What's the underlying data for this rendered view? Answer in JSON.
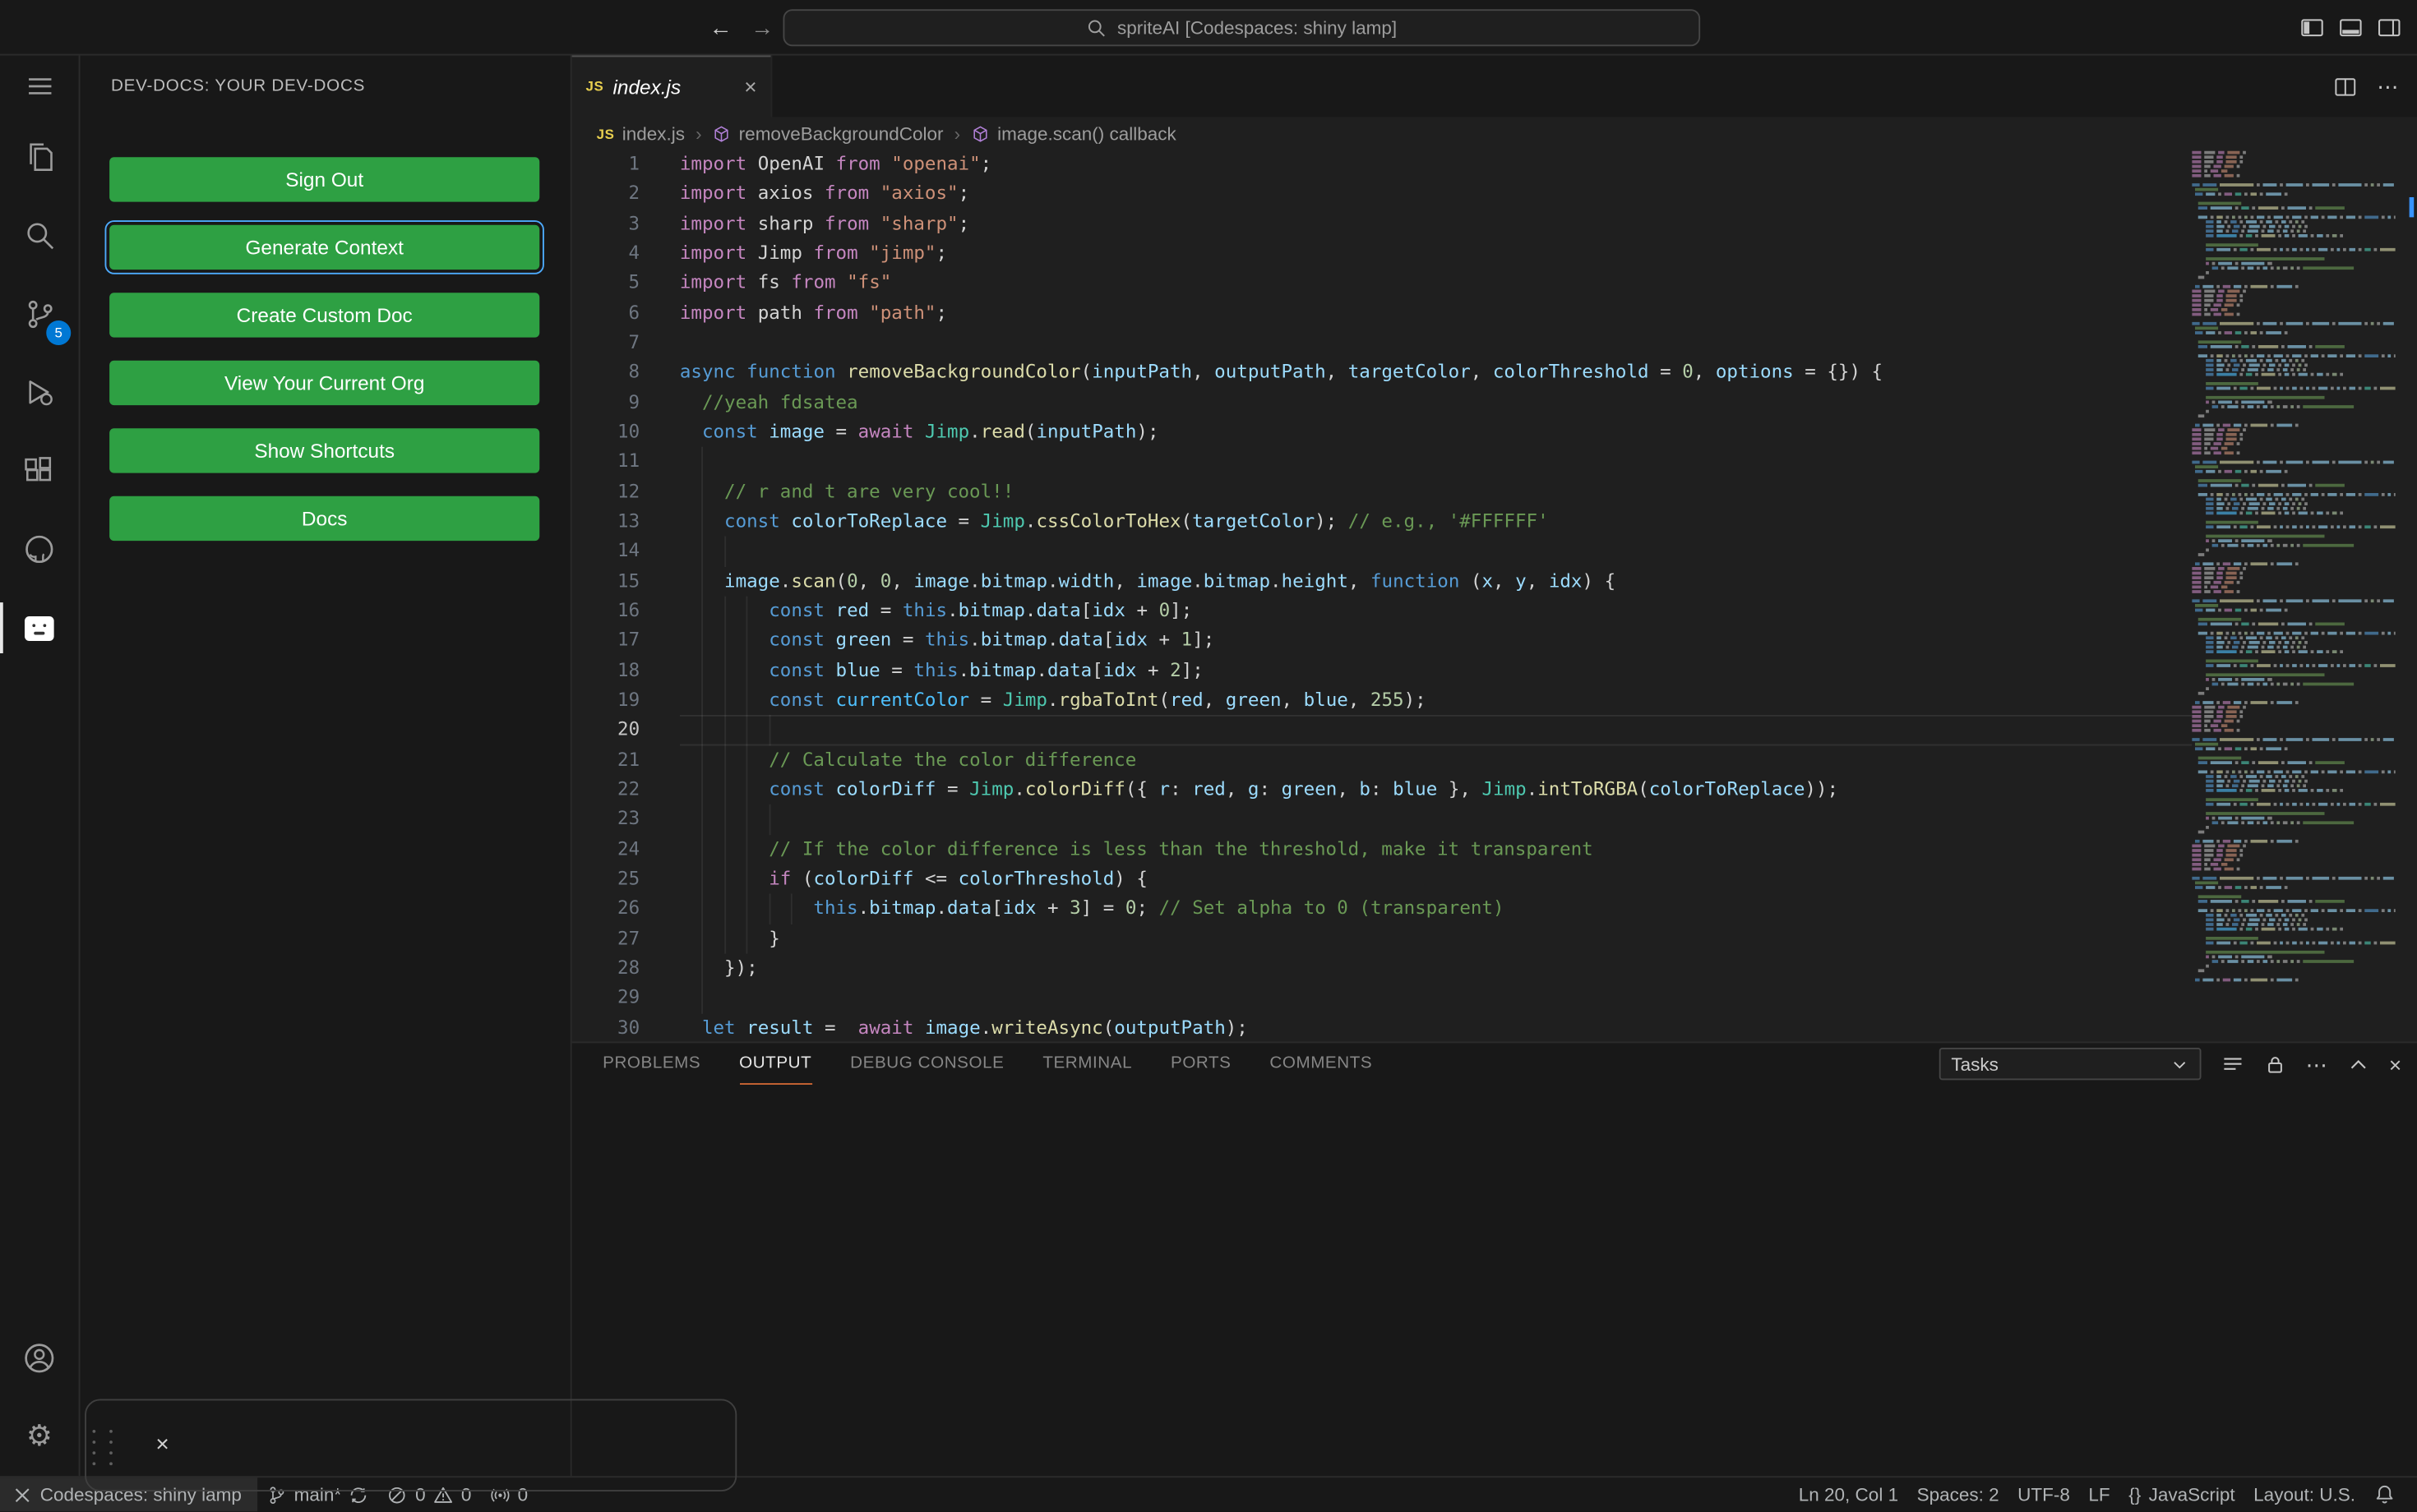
{
  "colors": {
    "accent_green": "#2ea043",
    "focus_blue": "#4daafc",
    "badge_blue": "#0078d4",
    "panel_active_border": "#cc6633"
  },
  "icons": {
    "back": "←",
    "forward": "→",
    "more": "⋯",
    "close": "×",
    "gear": "⚙",
    "js": "JS",
    "braces": "{}"
  },
  "titlebar": {
    "search_label": "spriteAI [Codespaces: shiny lamp]"
  },
  "activity_bar": {
    "source_control_badge": "5"
  },
  "sidebar": {
    "title": "DEV-DOCS: YOUR DEV-DOCS",
    "buttons": [
      {
        "label": "Sign Out",
        "focused": false
      },
      {
        "label": "Generate Context",
        "focused": true
      },
      {
        "label": "Create Custom Doc",
        "focused": false
      },
      {
        "label": "View Your Current Org",
        "focused": false
      },
      {
        "label": "Show Shortcuts",
        "focused": false
      },
      {
        "label": "Docs",
        "focused": false
      }
    ]
  },
  "editor": {
    "tab": {
      "label": "index.js"
    },
    "breadcrumbs": [
      {
        "label": "index.js",
        "icon": "js"
      },
      {
        "label": "removeBackgroundColor",
        "icon": "symbol"
      },
      {
        "label": "image.scan() callback",
        "icon": "symbol"
      }
    ],
    "active_line": 20,
    "lines": [
      {
        "n": 1,
        "i": 0,
        "t": [
          [
            "k",
            "import "
          ],
          [
            "p",
            "OpenAI "
          ],
          [
            "k",
            "from "
          ],
          [
            "s",
            "\"openai\""
          ],
          [
            "p",
            ";"
          ]
        ]
      },
      {
        "n": 2,
        "i": 0,
        "t": [
          [
            "k",
            "import "
          ],
          [
            "p",
            "axios "
          ],
          [
            "k",
            "from "
          ],
          [
            "s",
            "\"axios\""
          ],
          [
            "p",
            ";"
          ]
        ]
      },
      {
        "n": 3,
        "i": 0,
        "t": [
          [
            "k",
            "import "
          ],
          [
            "p",
            "sharp "
          ],
          [
            "k",
            "from "
          ],
          [
            "s",
            "\"sharp\""
          ],
          [
            "p",
            ";"
          ]
        ]
      },
      {
        "n": 4,
        "i": 0,
        "t": [
          [
            "k",
            "import "
          ],
          [
            "p",
            "Jimp "
          ],
          [
            "k",
            "from "
          ],
          [
            "s",
            "\"jimp\""
          ],
          [
            "p",
            ";"
          ]
        ]
      },
      {
        "n": 5,
        "i": 0,
        "t": [
          [
            "k",
            "import "
          ],
          [
            "p",
            "fs "
          ],
          [
            "k",
            "from "
          ],
          [
            "s",
            "\"fs\""
          ]
        ]
      },
      {
        "n": 6,
        "i": 0,
        "t": [
          [
            "k",
            "import "
          ],
          [
            "p",
            "path "
          ],
          [
            "k",
            "from "
          ],
          [
            "s",
            "\"path\""
          ],
          [
            "p",
            ";"
          ]
        ]
      },
      {
        "n": 7,
        "i": 0,
        "t": []
      },
      {
        "n": 8,
        "i": 0,
        "t": [
          [
            "d",
            "async "
          ],
          [
            "d",
            "function "
          ],
          [
            "f",
            "removeBackgroundColor"
          ],
          [
            "p",
            "("
          ],
          [
            "v",
            "inputPath"
          ],
          [
            "p",
            ", "
          ],
          [
            "v",
            "outputPath"
          ],
          [
            "p",
            ", "
          ],
          [
            "v",
            "targetColor"
          ],
          [
            "p",
            ", "
          ],
          [
            "v",
            "colorThreshold"
          ],
          [
            "p",
            " = "
          ],
          [
            "n",
            "0"
          ],
          [
            "p",
            ", "
          ],
          [
            "v",
            "options"
          ],
          [
            "p",
            " = {}) {"
          ]
        ]
      },
      {
        "n": 9,
        "i": 2,
        "t": [
          [
            "c",
            "//yeah fdsatea"
          ]
        ]
      },
      {
        "n": 10,
        "i": 2,
        "t": [
          [
            "d",
            "const "
          ],
          [
            "v",
            "image"
          ],
          [
            "p",
            " = "
          ],
          [
            "k",
            "await "
          ],
          [
            "t",
            "Jimp"
          ],
          [
            "p",
            "."
          ],
          [
            "f",
            "read"
          ],
          [
            "p",
            "("
          ],
          [
            "v",
            "inputPath"
          ],
          [
            "p",
            ");"
          ]
        ]
      },
      {
        "n": 11,
        "i": 2,
        "t": []
      },
      {
        "n": 12,
        "i": 4,
        "t": [
          [
            "c",
            "// r and t are very cool!!"
          ]
        ]
      },
      {
        "n": 13,
        "i": 4,
        "t": [
          [
            "d",
            "const "
          ],
          [
            "v",
            "colorToReplace"
          ],
          [
            "p",
            " = "
          ],
          [
            "t",
            "Jimp"
          ],
          [
            "p",
            "."
          ],
          [
            "f",
            "cssColorToHex"
          ],
          [
            "p",
            "("
          ],
          [
            "v",
            "targetColor"
          ],
          [
            "p",
            ");"
          ],
          [
            "c",
            " // e.g., '#FFFFFF'"
          ]
        ]
      },
      {
        "n": 14,
        "i": 4,
        "t": []
      },
      {
        "n": 15,
        "i": 4,
        "t": [
          [
            "v",
            "image"
          ],
          [
            "p",
            "."
          ],
          [
            "f",
            "scan"
          ],
          [
            "p",
            "("
          ],
          [
            "n",
            "0"
          ],
          [
            "p",
            ", "
          ],
          [
            "n",
            "0"
          ],
          [
            "p",
            ", "
          ],
          [
            "v",
            "image"
          ],
          [
            "p",
            "."
          ],
          [
            "v",
            "bitmap"
          ],
          [
            "p",
            "."
          ],
          [
            "v",
            "width"
          ],
          [
            "p",
            ", "
          ],
          [
            "v",
            "image"
          ],
          [
            "p",
            "."
          ],
          [
            "v",
            "bitmap"
          ],
          [
            "p",
            "."
          ],
          [
            "v",
            "height"
          ],
          [
            "p",
            ", "
          ],
          [
            "d",
            "function "
          ],
          [
            "p",
            "("
          ],
          [
            "v",
            "x"
          ],
          [
            "p",
            ", "
          ],
          [
            "v",
            "y"
          ],
          [
            "p",
            ", "
          ],
          [
            "v",
            "idx"
          ],
          [
            "p",
            ") {"
          ]
        ]
      },
      {
        "n": 16,
        "i": 8,
        "t": [
          [
            "d",
            "const "
          ],
          [
            "v",
            "red"
          ],
          [
            "p",
            " = "
          ],
          [
            "d",
            "this"
          ],
          [
            "p",
            "."
          ],
          [
            "v",
            "bitmap"
          ],
          [
            "p",
            "."
          ],
          [
            "v",
            "data"
          ],
          [
            "p",
            "["
          ],
          [
            "v",
            "idx"
          ],
          [
            "p",
            " + "
          ],
          [
            "n",
            "0"
          ],
          [
            "p",
            "];"
          ]
        ]
      },
      {
        "n": 17,
        "i": 8,
        "t": [
          [
            "d",
            "const "
          ],
          [
            "v",
            "green"
          ],
          [
            "p",
            " = "
          ],
          [
            "d",
            "this"
          ],
          [
            "p",
            "."
          ],
          [
            "v",
            "bitmap"
          ],
          [
            "p",
            "."
          ],
          [
            "v",
            "data"
          ],
          [
            "p",
            "["
          ],
          [
            "v",
            "idx"
          ],
          [
            "p",
            " + "
          ],
          [
            "n",
            "1"
          ],
          [
            "p",
            "];"
          ]
        ]
      },
      {
        "n": 18,
        "i": 8,
        "t": [
          [
            "d",
            "const "
          ],
          [
            "v",
            "blue"
          ],
          [
            "p",
            " = "
          ],
          [
            "d",
            "this"
          ],
          [
            "p",
            "."
          ],
          [
            "v",
            "bitmap"
          ],
          [
            "p",
            "."
          ],
          [
            "v",
            "data"
          ],
          [
            "p",
            "["
          ],
          [
            "v",
            "idx"
          ],
          [
            "p",
            " + "
          ],
          [
            "n",
            "2"
          ],
          [
            "p",
            "];"
          ]
        ]
      },
      {
        "n": 19,
        "i": 8,
        "t": [
          [
            "d",
            "const "
          ],
          [
            "u",
            "currentColor"
          ],
          [
            "p",
            " = "
          ],
          [
            "t",
            "Jimp"
          ],
          [
            "p",
            "."
          ],
          [
            "f",
            "rgbaToInt"
          ],
          [
            "p",
            "("
          ],
          [
            "v",
            "red"
          ],
          [
            "p",
            ", "
          ],
          [
            "v",
            "green"
          ],
          [
            "p",
            ", "
          ],
          [
            "v",
            "blue"
          ],
          [
            "p",
            ", "
          ],
          [
            "n",
            "255"
          ],
          [
            "p",
            ");"
          ]
        ]
      },
      {
        "n": 20,
        "i": 8,
        "t": []
      },
      {
        "n": 21,
        "i": 8,
        "t": [
          [
            "c",
            "// Calculate the color difference"
          ]
        ]
      },
      {
        "n": 22,
        "i": 8,
        "t": [
          [
            "d",
            "const "
          ],
          [
            "v",
            "colorDiff"
          ],
          [
            "p",
            " = "
          ],
          [
            "t",
            "Jimp"
          ],
          [
            "p",
            "."
          ],
          [
            "f",
            "colorDiff"
          ],
          [
            "p",
            "({ "
          ],
          [
            "v",
            "r"
          ],
          [
            "p",
            ": "
          ],
          [
            "v",
            "red"
          ],
          [
            "p",
            ", "
          ],
          [
            "v",
            "g"
          ],
          [
            "p",
            ": "
          ],
          [
            "v",
            "green"
          ],
          [
            "p",
            ", "
          ],
          [
            "v",
            "b"
          ],
          [
            "p",
            ": "
          ],
          [
            "v",
            "blue"
          ],
          [
            "p",
            " }, "
          ],
          [
            "t",
            "Jimp"
          ],
          [
            "p",
            "."
          ],
          [
            "f",
            "intToRGBA"
          ],
          [
            "p",
            "("
          ],
          [
            "v",
            "colorToReplace"
          ],
          [
            "p",
            "));"
          ]
        ]
      },
      {
        "n": 23,
        "i": 8,
        "t": []
      },
      {
        "n": 24,
        "i": 8,
        "t": [
          [
            "c",
            "// If the color difference is less than the threshold, make it transparent"
          ]
        ]
      },
      {
        "n": 25,
        "i": 8,
        "t": [
          [
            "k",
            "if "
          ],
          [
            "p",
            "("
          ],
          [
            "v",
            "colorDiff"
          ],
          [
            "p",
            " <= "
          ],
          [
            "v",
            "colorThreshold"
          ],
          [
            "p",
            ") {"
          ]
        ]
      },
      {
        "n": 26,
        "i": 12,
        "t": [
          [
            "d",
            "this"
          ],
          [
            "p",
            "."
          ],
          [
            "v",
            "bitmap"
          ],
          [
            "p",
            "."
          ],
          [
            "v",
            "data"
          ],
          [
            "p",
            "["
          ],
          [
            "v",
            "idx"
          ],
          [
            "p",
            " + "
          ],
          [
            "n",
            "3"
          ],
          [
            "p",
            "] = "
          ],
          [
            "n",
            "0"
          ],
          [
            "p",
            ";"
          ],
          [
            "c",
            " // Set alpha to 0 (transparent)"
          ]
        ]
      },
      {
        "n": 27,
        "i": 8,
        "t": [
          [
            "p",
            "}"
          ]
        ]
      },
      {
        "n": 28,
        "i": 4,
        "t": [
          [
            "p",
            "});"
          ]
        ]
      },
      {
        "n": 29,
        "i": 2,
        "t": []
      },
      {
        "n": 30,
        "i": 2,
        "t": [
          [
            "d",
            "let "
          ],
          [
            "v",
            "result"
          ],
          [
            "p",
            " =  "
          ],
          [
            "k",
            "await "
          ],
          [
            "v",
            "image"
          ],
          [
            "p",
            "."
          ],
          [
            "f",
            "writeAsync"
          ],
          [
            "p",
            "("
          ],
          [
            "v",
            "outputPath"
          ],
          [
            "p",
            ");"
          ]
        ]
      }
    ]
  },
  "panel": {
    "tabs": [
      {
        "label": "PROBLEMS",
        "active": false
      },
      {
        "label": "OUTPUT",
        "active": true
      },
      {
        "label": "DEBUG CONSOLE",
        "active": false
      },
      {
        "label": "TERMINAL",
        "active": false
      },
      {
        "label": "PORTS",
        "active": false
      },
      {
        "label": "COMMENTS",
        "active": false
      }
    ],
    "dropdown_value": "Tasks"
  },
  "status_bar": {
    "remote_label": "Codespaces: shiny lamp",
    "branch": "main*",
    "errors": "0",
    "warnings": "0",
    "ports": "0",
    "cursor": "Ln 20, Col 1",
    "indentation": "Spaces: 2",
    "encoding": "UTF-8",
    "eol": "LF",
    "language": "JavaScript",
    "layout": "Layout: U.S."
  }
}
